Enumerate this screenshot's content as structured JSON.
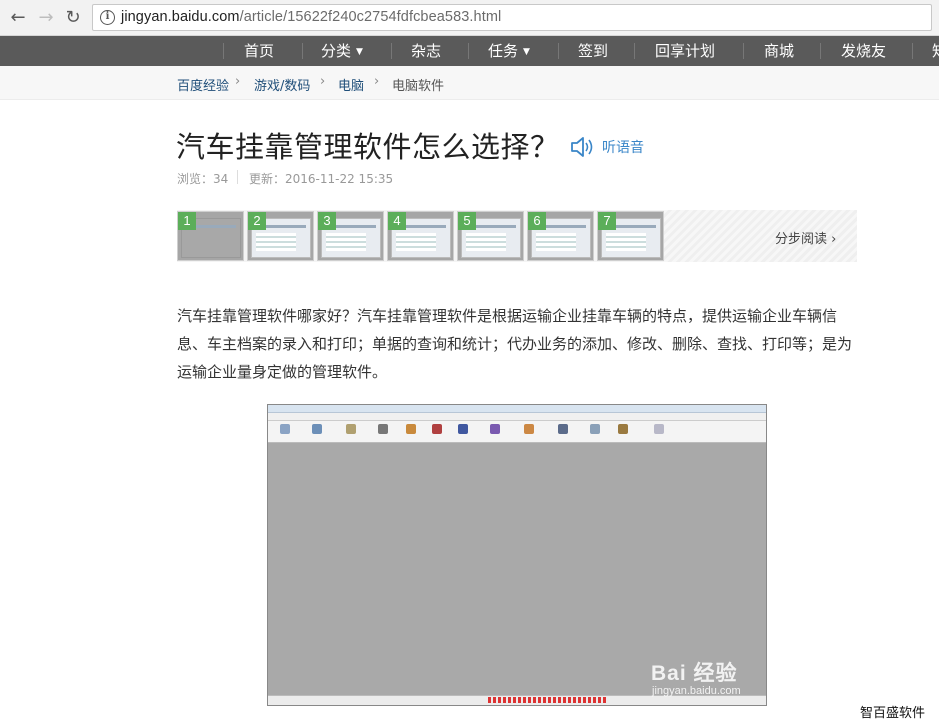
{
  "browser": {
    "url_host": "jingyan.baidu.com",
    "url_path": "/article/15622f240c2754fdfcbea583.html"
  },
  "nav": {
    "items": [
      "首页",
      "分类",
      "杂志",
      "任务",
      "签到",
      "回享计划",
      "商城",
      "发烧友",
      "知"
    ]
  },
  "breadcrumb": [
    "百度经验",
    "游戏/数码",
    "电脑",
    "电脑软件"
  ],
  "article": {
    "title": "汽车挂靠管理软件怎么选择？",
    "listen_label": "听语音",
    "views_label": "浏览：34",
    "updated_label": "更新：2016-11-22 15:35",
    "paragraph": "汽车挂靠管理软件哪家好？汽车挂靠管理软件是根据运输企业挂靠车辆的特点，提供运输企业车辆信息、车主档案的录入和打印；单据的查询和统计；代办业务的添加、修改、删除、查找、打印等；是为运输企业量身定做的管理软件。"
  },
  "steps": {
    "numbers": [
      "1",
      "2",
      "3",
      "4",
      "5",
      "6",
      "7"
    ],
    "read_label": "分步阅读 ›"
  },
  "watermark": {
    "logo": "Bai 经验",
    "url": "jingyan.baidu.com"
  },
  "corner_note": "智百盛软件",
  "colors": {
    "nav_bg": "#5a5a5a",
    "step_badge": "#5cae5a",
    "link_blue": "#3a86c8"
  }
}
